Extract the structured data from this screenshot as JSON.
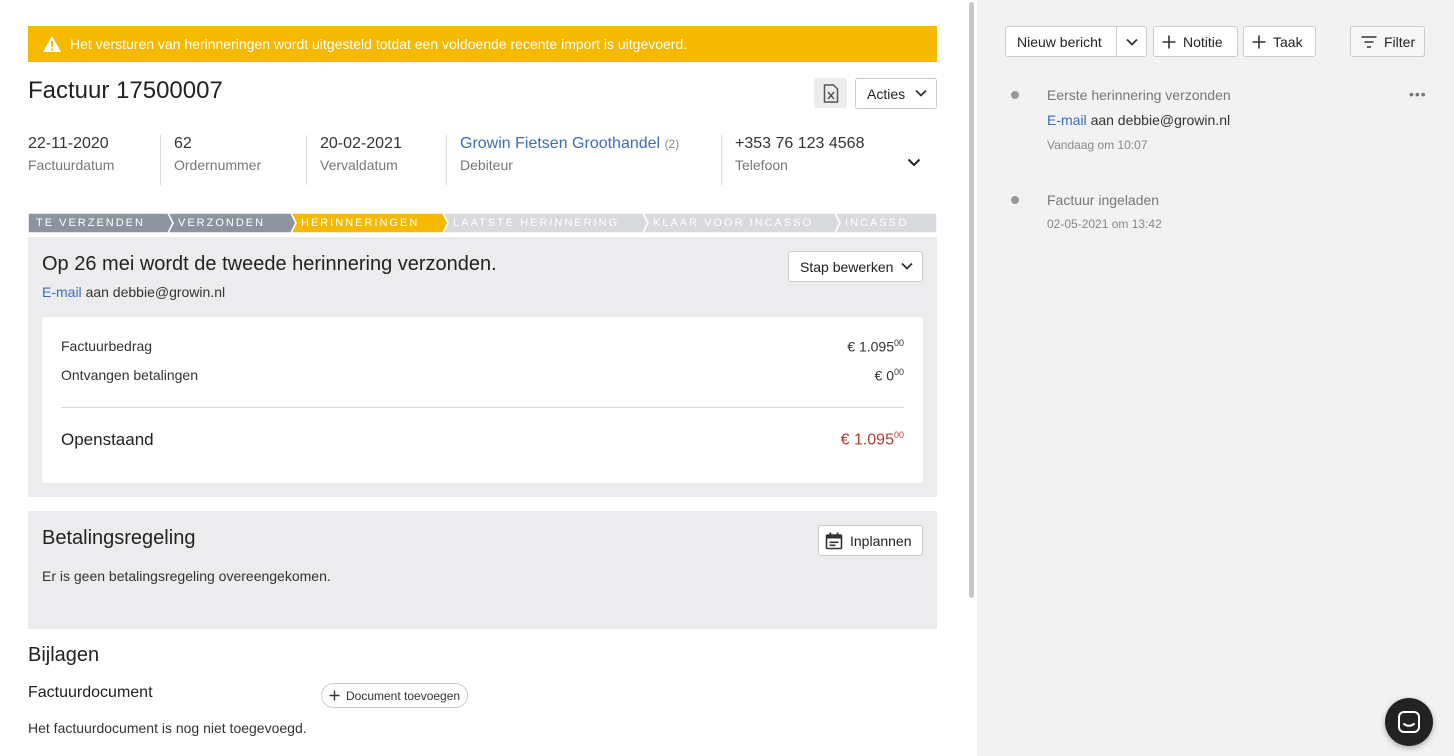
{
  "banner": {
    "text": "Het versturen van herinneringen wordt uitgesteld totdat een voldoende recente import is uitgevoerd."
  },
  "invoice": {
    "title": "Factuur 17500007",
    "actions_label": "Acties"
  },
  "meta": {
    "invoice_date": {
      "value": "22-11-2020",
      "label": "Factuurdatum"
    },
    "order": {
      "value": "62",
      "label": "Ordernummer"
    },
    "due_date": {
      "value": "20-02-2021",
      "label": "Vervaldatum"
    },
    "debtor": {
      "value": "Growin Fietsen Groothandel",
      "count": "(2)",
      "label": "Debiteur"
    },
    "phone": {
      "value": "+353 76 123 4568",
      "label": "Telefoon"
    }
  },
  "steps": [
    {
      "label": "TE VERZENDEN",
      "state": "done"
    },
    {
      "label": "VERZONDEN",
      "state": "done"
    },
    {
      "label": "HERINNERINGEN",
      "state": "active"
    },
    {
      "label": "LAATSTE HERINNERING",
      "state": "pending"
    },
    {
      "label": "KLAAR VOOR INCASSO",
      "state": "pending"
    },
    {
      "label": "INCASSO",
      "state": "pending"
    }
  ],
  "next_step": {
    "heading": "Op 26 mei wordt de tweede herinnering verzonden.",
    "channel": "E-mail",
    "recipient": "aan debbie@growin.nl",
    "edit_label": "Stap bewerken"
  },
  "amounts": {
    "invoice_label": "Factuurbedrag",
    "invoice_main": "€ 1.095",
    "invoice_cents": "00",
    "received_label": "Ontvangen betalingen",
    "received_main": "€ 0",
    "received_cents": "00",
    "open_label": "Openstaand",
    "open_main": "€ 1.095",
    "open_cents": "00"
  },
  "arrangement": {
    "heading": "Betalingsregeling",
    "plan_label": "Inplannen",
    "text": "Er is geen betalingsregeling overeengekomen."
  },
  "attachments": {
    "heading": "Bijlagen",
    "doc_heading": "Factuurdocument",
    "add_label": "Document toevoegen",
    "empty_text": "Het factuurdocument is nog niet toegevoegd."
  },
  "sidebar": {
    "new_message": "Nieuw bericht",
    "note": "Notitie",
    "task": "Taak",
    "filter": "Filter",
    "timeline": [
      {
        "title": "Eerste herinnering verzonden",
        "channel": "E-mail",
        "recipient": "aan debbie@growin.nl",
        "time": "Vandaag om 10:07"
      },
      {
        "title": "Factuur ingeladen",
        "time": "02-05-2021 om 13:42"
      }
    ]
  },
  "colors": {
    "accent": "#f5b900",
    "link": "#3b6dbf",
    "step_done": "#8d949e",
    "step_pending": "#d9dadd",
    "overdue": "#b03a2e"
  },
  "icons": [
    "warning-icon",
    "excel-file-icon",
    "chevron-down-icon",
    "calendar-icon",
    "plus-icon",
    "filter-icon",
    "more-icon",
    "chat-icon"
  ]
}
